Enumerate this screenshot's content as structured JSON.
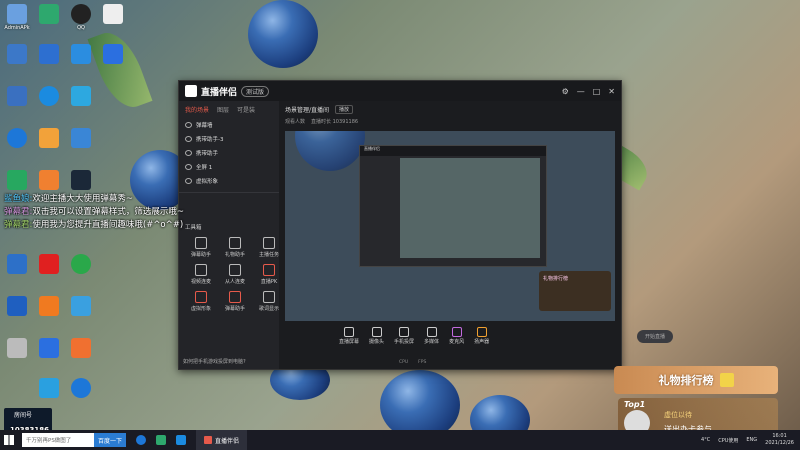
{
  "desktop": {
    "icons": [
      "AdminAPk",
      "",
      "QQ",
      "",
      "",
      "",
      "",
      "",
      "",
      "",
      "",
      "",
      "",
      "",
      "",
      "",
      "",
      "",
      "",
      "",
      "",
      "",
      "",
      "",
      "",
      "",
      "",
      "",
      "",
      "",
      ""
    ]
  },
  "app": {
    "title": "直播伴侣",
    "version": "测试版",
    "left_tabs": [
      "我的场景",
      "图层",
      "可是装"
    ],
    "layers": [
      "弹幕墙",
      "携带助手-3",
      "携带助手",
      "全屏 1",
      "虚拟形象"
    ],
    "tools_label": "工具箱",
    "tools": [
      "弹幕助手",
      "礼物助手",
      "主播任务",
      "视频连麦",
      "从人连麦",
      "直播PK",
      "虚拟形象",
      "弹幕助手",
      "歌词显示",
      "",
      "",
      ""
    ],
    "notice": "如何把手机游戏投屏到电脑?",
    "scene_title": "场景管理/直播间",
    "scene_tag": "播放",
    "info": [
      "观看人数",
      "直播时长 10391186"
    ],
    "bottom_tools": [
      "直播屏幕",
      "摄像头",
      "手机投屏",
      "多媒体",
      "麦克风",
      "扬声器"
    ],
    "live_button": "开始直播",
    "status": [
      "CPU",
      "FPS"
    ],
    "gift_tag": "礼物排行榜"
  },
  "danmu": [
    {
      "name": "鲨鱼娘:",
      "text": "欢迎主播大大使用弹幕秀~"
    },
    {
      "name": "弹幕君:",
      "text": "双击我可以设置弹幕样式，筛选展示哦~"
    },
    {
      "name": "弹幕君:",
      "text": "使用我为您提升直播间趣味哦(#^o^#)"
    }
  ],
  "rank": {
    "title": "礼物排行榜"
  },
  "top1": {
    "badge": "Top1",
    "name": "虚位以待",
    "action": "送出办卡参与"
  },
  "stream_room": {
    "label": "房间号",
    "id": "10383186"
  },
  "taskbar": {
    "search_placeholder": "千万别再PS做图了",
    "search_button": "百度一下",
    "active_app": "直播伴侣",
    "tray": {
      "temp": "4°C",
      "cpu": "CPU使用",
      "lang": "ENG",
      "time": "16:01",
      "date": "2021/12/26"
    }
  }
}
